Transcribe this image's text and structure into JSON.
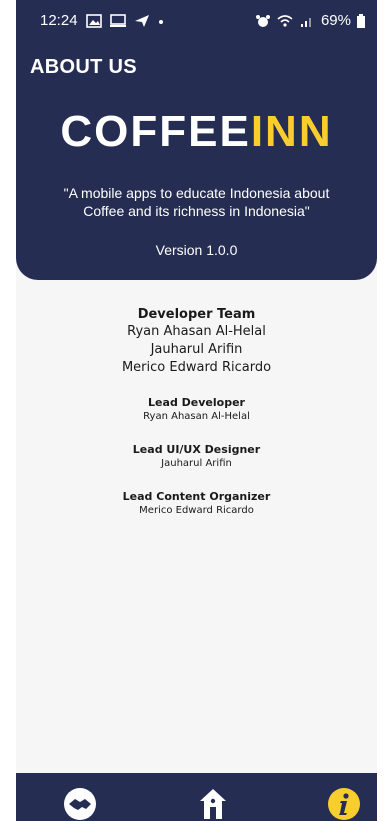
{
  "status_bar": {
    "time": "12:24",
    "battery": "69%"
  },
  "header": {
    "title": "ABOUT US",
    "logo_part1": "COFFEE",
    "logo_part2": "INN",
    "tagline": "\"A mobile apps to educate Indonesia about Coffee and its richness in Indonesia\"",
    "version": "Version 1.0.0"
  },
  "team": {
    "title": "Developer Team",
    "members": [
      "Ryan Ahasan Al-Helal",
      "Jauharul Arifin",
      "Merico Edward Ricardo"
    ]
  },
  "roles": [
    {
      "title": "Lead Developer",
      "name": "Ryan Ahasan Al-Helal"
    },
    {
      "title": "Lead UI/UX Designer",
      "name": "Jauharul Arifin"
    },
    {
      "title": "Lead Content Organizer",
      "name": "Merico Edward Ricardo"
    }
  ],
  "bottom_nav": {
    "items": [
      {
        "icon": "handshake-icon"
      },
      {
        "icon": "home-icon"
      },
      {
        "icon": "info-icon"
      }
    ]
  },
  "colors": {
    "primary_navy": "#262d52",
    "accent_yellow": "#f8cd2e",
    "background": "#f6f6f6"
  }
}
